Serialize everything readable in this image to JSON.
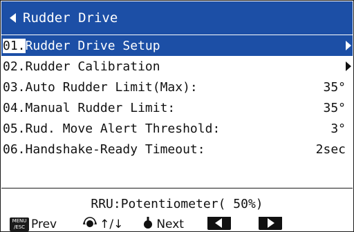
{
  "header": {
    "title": "Rudder Drive"
  },
  "menu": {
    "items": [
      {
        "num": "01.",
        "label": "Rudder Drive Setup",
        "value": "",
        "submenu": true,
        "selected": true
      },
      {
        "num": "02.",
        "label": "Rudder Calibration",
        "value": "",
        "submenu": true,
        "selected": false
      },
      {
        "num": "03.",
        "label": "Auto Rudder Limit(Max):",
        "value": "35°",
        "submenu": false,
        "selected": false
      },
      {
        "num": "04.",
        "label": "Manual Rudder Limit:",
        "value": "35°",
        "submenu": false,
        "selected": false
      },
      {
        "num": "05.",
        "label": "Rud. Move Alert Threshold:",
        "value": "3°",
        "submenu": false,
        "selected": false
      },
      {
        "num": "06.",
        "label": "Handshake-Ready Timeout:",
        "value": "2sec",
        "submenu": false,
        "selected": false
      }
    ]
  },
  "status": {
    "text": "RRU:Potentiometer( 50%)"
  },
  "footer": {
    "menu_key_top": "MENU",
    "menu_key_bottom": "/ESC",
    "prev_label": "Prev",
    "knob_label": "↑/↓",
    "next_label": "Next"
  }
}
